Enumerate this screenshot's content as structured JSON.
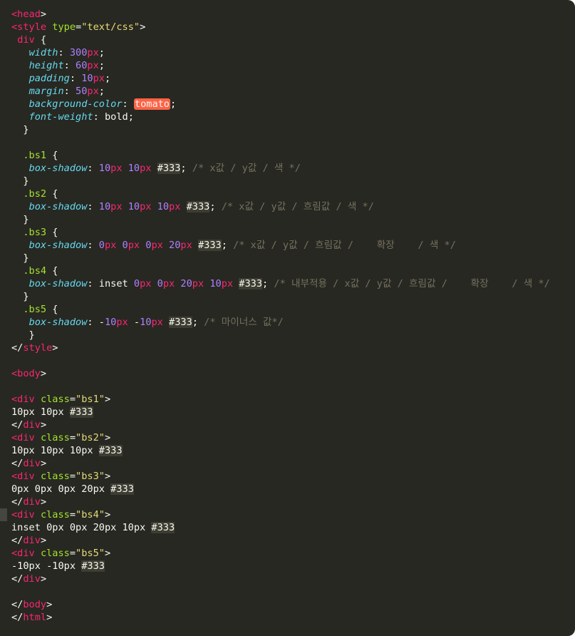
{
  "editor": {
    "lines": [
      [
        [
          "t",
          "<head"
        ],
        [
          "",
          ">"
        ]
      ],
      [
        [
          "t",
          "<style"
        ],
        [
          "",
          " "
        ],
        [
          "a",
          "type"
        ],
        [
          "",
          "="
        ],
        [
          "s",
          "\"text/css\""
        ],
        [
          "",
          ">"
        ]
      ],
      [
        [
          "",
          " "
        ],
        [
          "t",
          "div"
        ],
        [
          "",
          " {"
        ]
      ],
      [
        [
          "",
          "   "
        ],
        [
          "p",
          "width"
        ],
        [
          "",
          ": "
        ],
        [
          "n",
          "300"
        ],
        [
          "u",
          "px"
        ],
        [
          "",
          ";"
        ]
      ],
      [
        [
          "",
          "   "
        ],
        [
          "p",
          "height"
        ],
        [
          "",
          ": "
        ],
        [
          "n",
          "60"
        ],
        [
          "u",
          "px"
        ],
        [
          "",
          ";"
        ]
      ],
      [
        [
          "",
          "   "
        ],
        [
          "p",
          "padding"
        ],
        [
          "",
          ": "
        ],
        [
          "n",
          "10"
        ],
        [
          "u",
          "px"
        ],
        [
          "",
          ";"
        ]
      ],
      [
        [
          "",
          "   "
        ],
        [
          "p",
          "margin"
        ],
        [
          "",
          ": "
        ],
        [
          "n",
          "50"
        ],
        [
          "u",
          "px"
        ],
        [
          "",
          ";"
        ]
      ],
      [
        [
          "",
          "   "
        ],
        [
          "p",
          "background-color"
        ],
        [
          "",
          ": "
        ],
        [
          "tomato",
          "tomato"
        ],
        [
          "",
          ";"
        ]
      ],
      [
        [
          "",
          "   "
        ],
        [
          "p",
          "font-weight"
        ],
        [
          "",
          ": bold;"
        ]
      ],
      [
        [
          "",
          "  }"
        ]
      ],
      [],
      [
        [
          "",
          "  "
        ],
        [
          "a",
          ".bs1"
        ],
        [
          "",
          " {"
        ]
      ],
      [
        [
          "",
          "   "
        ],
        [
          "p",
          "box-shadow"
        ],
        [
          "",
          ": "
        ],
        [
          "n",
          "10"
        ],
        [
          "u",
          "px"
        ],
        [
          "",
          " "
        ],
        [
          "n",
          "10"
        ],
        [
          "u",
          "px"
        ],
        [
          "",
          " "
        ],
        [
          "hex",
          "#333"
        ],
        [
          "",
          "; "
        ],
        [
          "c",
          "/* x값 / y값 / 색 */"
        ]
      ],
      [
        [
          "",
          "  }"
        ]
      ],
      [
        [
          "",
          "  "
        ],
        [
          "a",
          ".bs2"
        ],
        [
          "",
          " {"
        ]
      ],
      [
        [
          "",
          "   "
        ],
        [
          "p",
          "box-shadow"
        ],
        [
          "",
          ": "
        ],
        [
          "n",
          "10"
        ],
        [
          "u",
          "px"
        ],
        [
          "",
          " "
        ],
        [
          "n",
          "10"
        ],
        [
          "u",
          "px"
        ],
        [
          "",
          " "
        ],
        [
          "n",
          "10"
        ],
        [
          "u",
          "px"
        ],
        [
          "",
          " "
        ],
        [
          "hex",
          "#333"
        ],
        [
          "",
          "; "
        ],
        [
          "c",
          "/* x값 / y값 / 흐림값 / 색 */"
        ]
      ],
      [
        [
          "",
          "  }"
        ]
      ],
      [
        [
          "",
          "  "
        ],
        [
          "a",
          ".bs3"
        ],
        [
          "",
          " {"
        ]
      ],
      [
        [
          "",
          "   "
        ],
        [
          "p",
          "box-shadow"
        ],
        [
          "",
          ": "
        ],
        [
          "n",
          "0"
        ],
        [
          "u",
          "px"
        ],
        [
          "",
          " "
        ],
        [
          "n",
          "0"
        ],
        [
          "u",
          "px"
        ],
        [
          "",
          " "
        ],
        [
          "n",
          "0"
        ],
        [
          "u",
          "px"
        ],
        [
          "",
          " "
        ],
        [
          "n",
          "20"
        ],
        [
          "u",
          "px"
        ],
        [
          "",
          " "
        ],
        [
          "hex",
          "#333"
        ],
        [
          "",
          "; "
        ],
        [
          "c",
          "/* x값 / y값 / 흐림값 /    확장    / 색 */"
        ]
      ],
      [
        [
          "",
          "  }"
        ]
      ],
      [
        [
          "",
          "  "
        ],
        [
          "a",
          ".bs4"
        ],
        [
          "",
          " {"
        ]
      ],
      [
        [
          "",
          "   "
        ],
        [
          "p",
          "box-shadow"
        ],
        [
          "",
          ": inset "
        ],
        [
          "n",
          "0"
        ],
        [
          "u",
          "px"
        ],
        [
          "",
          " "
        ],
        [
          "n",
          "0"
        ],
        [
          "u",
          "px"
        ],
        [
          "",
          " "
        ],
        [
          "n",
          "20"
        ],
        [
          "u",
          "px"
        ],
        [
          "",
          " "
        ],
        [
          "n",
          "10"
        ],
        [
          "u",
          "px"
        ],
        [
          "",
          " "
        ],
        [
          "hex",
          "#333"
        ],
        [
          "",
          "; "
        ],
        [
          "c",
          "/* 내부적용 / x값 / y값 / 흐림값 /    확장    / 색 */"
        ]
      ],
      [
        [
          "",
          "  }"
        ]
      ],
      [
        [
          "",
          "  "
        ],
        [
          "a",
          ".bs5"
        ],
        [
          "",
          " {"
        ]
      ],
      [
        [
          "",
          "   "
        ],
        [
          "p",
          "box-shadow"
        ],
        [
          "",
          ": -"
        ],
        [
          "n",
          "10"
        ],
        [
          "u",
          "px"
        ],
        [
          "",
          " -"
        ],
        [
          "n",
          "10"
        ],
        [
          "u",
          "px"
        ],
        [
          "",
          " "
        ],
        [
          "hex",
          "#333"
        ],
        [
          "",
          "; "
        ],
        [
          "c",
          "/* 마이너스 값*/"
        ]
      ],
      [
        [
          "",
          "   }"
        ]
      ],
      [
        [
          "",
          "</"
        ],
        [
          "t",
          "style"
        ],
        [
          "",
          ">"
        ]
      ],
      [],
      [
        [
          "t",
          "<body"
        ],
        [
          "",
          ">"
        ]
      ],
      [],
      [
        [
          "t",
          "<div"
        ],
        [
          "",
          " "
        ],
        [
          "a",
          "class"
        ],
        [
          "",
          "="
        ],
        [
          "s",
          "\"bs1\""
        ],
        [
          "",
          ">"
        ]
      ],
      [
        [
          "",
          "10px 10px "
        ],
        [
          "hex",
          "#333"
        ]
      ],
      [
        [
          "",
          "</"
        ],
        [
          "t",
          "div"
        ],
        [
          "",
          ">"
        ]
      ],
      [
        [
          "t",
          "<div"
        ],
        [
          "",
          " "
        ],
        [
          "a",
          "class"
        ],
        [
          "",
          "="
        ],
        [
          "s",
          "\"bs2\""
        ],
        [
          "",
          ">"
        ]
      ],
      [
        [
          "",
          "10px 10px 10px "
        ],
        [
          "hex",
          "#333"
        ]
      ],
      [
        [
          "",
          "</"
        ],
        [
          "t",
          "div"
        ],
        [
          "",
          ">"
        ]
      ],
      [
        [
          "t",
          "<div"
        ],
        [
          "",
          " "
        ],
        [
          "a",
          "class"
        ],
        [
          "",
          "="
        ],
        [
          "s",
          "\"bs3\""
        ],
        [
          "",
          ">"
        ]
      ],
      [
        [
          "",
          "0px 0px 0px 20px "
        ],
        [
          "hex",
          "#333"
        ]
      ],
      [
        [
          "",
          "</"
        ],
        [
          "t",
          "div"
        ],
        [
          "",
          ">"
        ]
      ],
      [
        [
          "t",
          "<div"
        ],
        [
          "",
          " "
        ],
        [
          "a",
          "class"
        ],
        [
          "",
          "="
        ],
        [
          "s",
          "\"bs4\""
        ],
        [
          "",
          ">"
        ]
      ],
      [
        [
          "",
          "inset 0px 0px 20px 10px "
        ],
        [
          "hex",
          "#333"
        ]
      ],
      [
        [
          "",
          "</"
        ],
        [
          "t",
          "div"
        ],
        [
          "",
          ">"
        ]
      ],
      [
        [
          "t",
          "<div"
        ],
        [
          "",
          " "
        ],
        [
          "a",
          "class"
        ],
        [
          "",
          "="
        ],
        [
          "s",
          "\"bs5\""
        ],
        [
          "",
          ">"
        ]
      ],
      [
        [
          "",
          "-10px -10px "
        ],
        [
          "hex",
          "#333"
        ]
      ],
      [
        [
          "",
          "</"
        ],
        [
          "t",
          "div"
        ],
        [
          "",
          ">"
        ]
      ],
      [],
      [
        [
          "",
          "</"
        ],
        [
          "t",
          "body"
        ],
        [
          "",
          ">"
        ]
      ],
      [
        [
          "",
          "</"
        ],
        [
          "t",
          "html"
        ],
        [
          "",
          ">"
        ]
      ]
    ]
  }
}
